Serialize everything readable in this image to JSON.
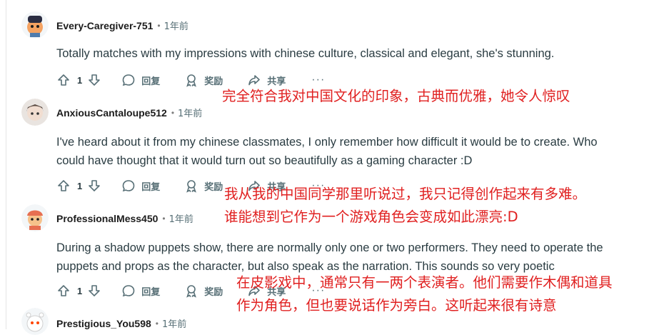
{
  "colors": {
    "translation_red": "#e02020",
    "meta_gray": "#576f76",
    "text": "#2a3c42"
  },
  "comments": [
    {
      "author": "Every-Caregiver-751",
      "time": "1年前",
      "text": "Totally matches with my impressions with chinese culture, classical and elegant, she's stunning.",
      "votes": "1",
      "reply_label": "回复",
      "award_label": "奖励",
      "share_label": "共享",
      "more_label": "···",
      "translation": [
        "完全符合我对中国文化的印象，古典而优雅，她令人惊叹"
      ]
    },
    {
      "author": "AnxiousCantaloupe512",
      "time": "1年前",
      "text_lines": [
        "I've heard about it from my chinese classmates, I only remember how difficult it would be to create. Who",
        "could have thought that it would turn out so beautifully as a gaming character :D"
      ],
      "votes": "1",
      "reply_label": "回复",
      "award_label": "奖励",
      "share_label": "共享",
      "more_label": "···",
      "translation": [
        "我从我的中国同学那里听说过，我只记得创作起来有多难。",
        "谁能想到它作为一个游戏角色会变成如此漂亮:D"
      ]
    },
    {
      "author": "ProfessionalMess450",
      "time": "1年前",
      "text_lines": [
        "During a shadow puppets show, there are normally only one or two performers. They need to operate the",
        "puppets and props as the character, but also speak as the narration. This sounds so very poetic"
      ],
      "votes": "1",
      "reply_label": "回复",
      "award_label": "奖励",
      "share_label": "共享",
      "more_label": "···",
      "translation": [
        "在皮影戏中，通常只有一两个表演者。他们需要作木偶和道具",
        "作为角色，但也要说话作为旁白。这听起来很有诗意"
      ]
    },
    {
      "author": "Prestigious_You598",
      "time": "1年前"
    }
  ]
}
